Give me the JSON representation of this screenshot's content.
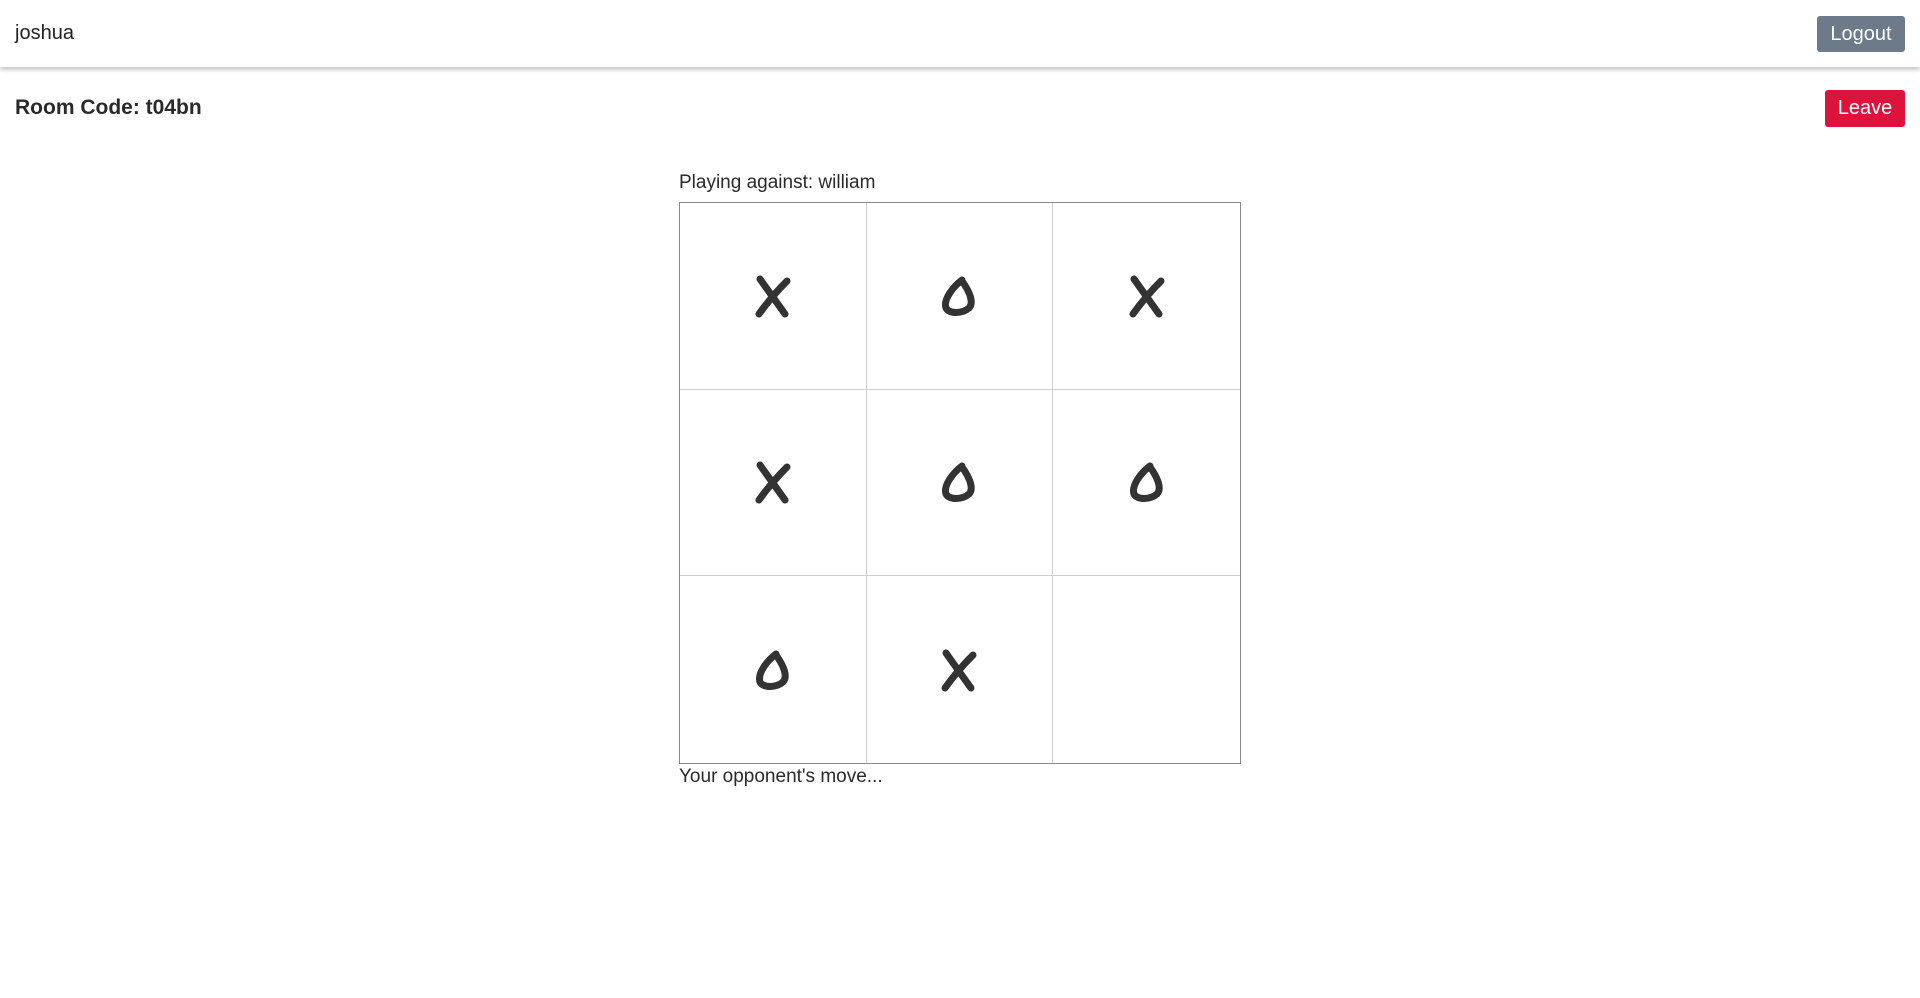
{
  "header": {
    "username": "joshua",
    "logout_label": "Logout"
  },
  "room": {
    "code_text": "Room Code: t04bn",
    "leave_label": "Leave"
  },
  "game": {
    "opponent_text": "Playing against: william",
    "status_text": "Your opponent's move...",
    "board": [
      [
        "X",
        "O",
        "X"
      ],
      [
        "X",
        "O",
        "O"
      ],
      [
        "O",
        "X",
        ""
      ]
    ]
  },
  "colors": {
    "logout_bg": "#6c7a89",
    "leave_bg": "#dc143c",
    "mark": "#333333"
  }
}
